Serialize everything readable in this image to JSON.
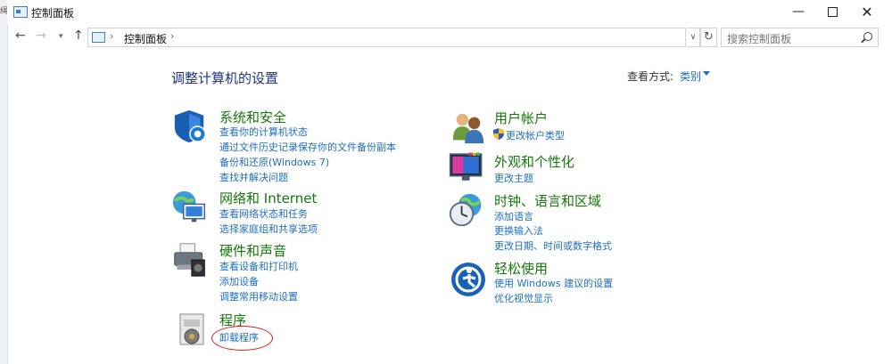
{
  "window": {
    "title": "控制面板",
    "minimize": "—",
    "close": "✕",
    "edge_char": "绳"
  },
  "nav": {
    "back": "←",
    "forward": "→",
    "recent": "▾",
    "up": "↑",
    "address": "控制面板",
    "address_sep": "›",
    "dropdown": "∨",
    "refresh": "↻",
    "search_placeholder": "搜索控制面板"
  },
  "content": {
    "heading": "调整计算机的设置",
    "view_by_label": "查看方式:",
    "view_by_value": "类别"
  },
  "categories": [
    {
      "title": "系统和安全",
      "icon": "shield-icon",
      "links": [
        "查看你的计算机状态",
        "通过文件历史记录保存你的文件备份副本",
        "备份和还原(Windows 7)",
        "查找并解决问题"
      ]
    },
    {
      "title": "网络和 Internet",
      "icon": "network-globe-icon",
      "links": [
        "查看网络状态和任务",
        "选择家庭组和共享选项"
      ]
    },
    {
      "title": "硬件和声音",
      "icon": "printer-icon",
      "links": [
        "查看设备和打印机",
        "添加设备",
        "调整常用移动设置"
      ]
    },
    {
      "title": "程序",
      "icon": "programs-icon",
      "links": [
        "卸载程序"
      ]
    },
    {
      "title": "用户帐户",
      "icon": "users-icon",
      "links": [
        "更改帐户类型"
      ]
    },
    {
      "title": "外观和个性化",
      "icon": "display-icon",
      "links": [
        "更改主题"
      ]
    },
    {
      "title": "时钟、语言和区域",
      "icon": "clock-globe-icon",
      "links": [
        "添加语言",
        "更换输入法",
        "更改日期、时间或数字格式"
      ]
    },
    {
      "title": "轻松使用",
      "icon": "accessibility-icon",
      "links": [
        "使用 Windows 建议的设置",
        "优化视觉显示"
      ]
    }
  ],
  "colors": {
    "category_title": "#14780b",
    "link": "#1e6fc2",
    "heading": "#1e3287",
    "highlight_ellipse": "#d11a1a"
  }
}
